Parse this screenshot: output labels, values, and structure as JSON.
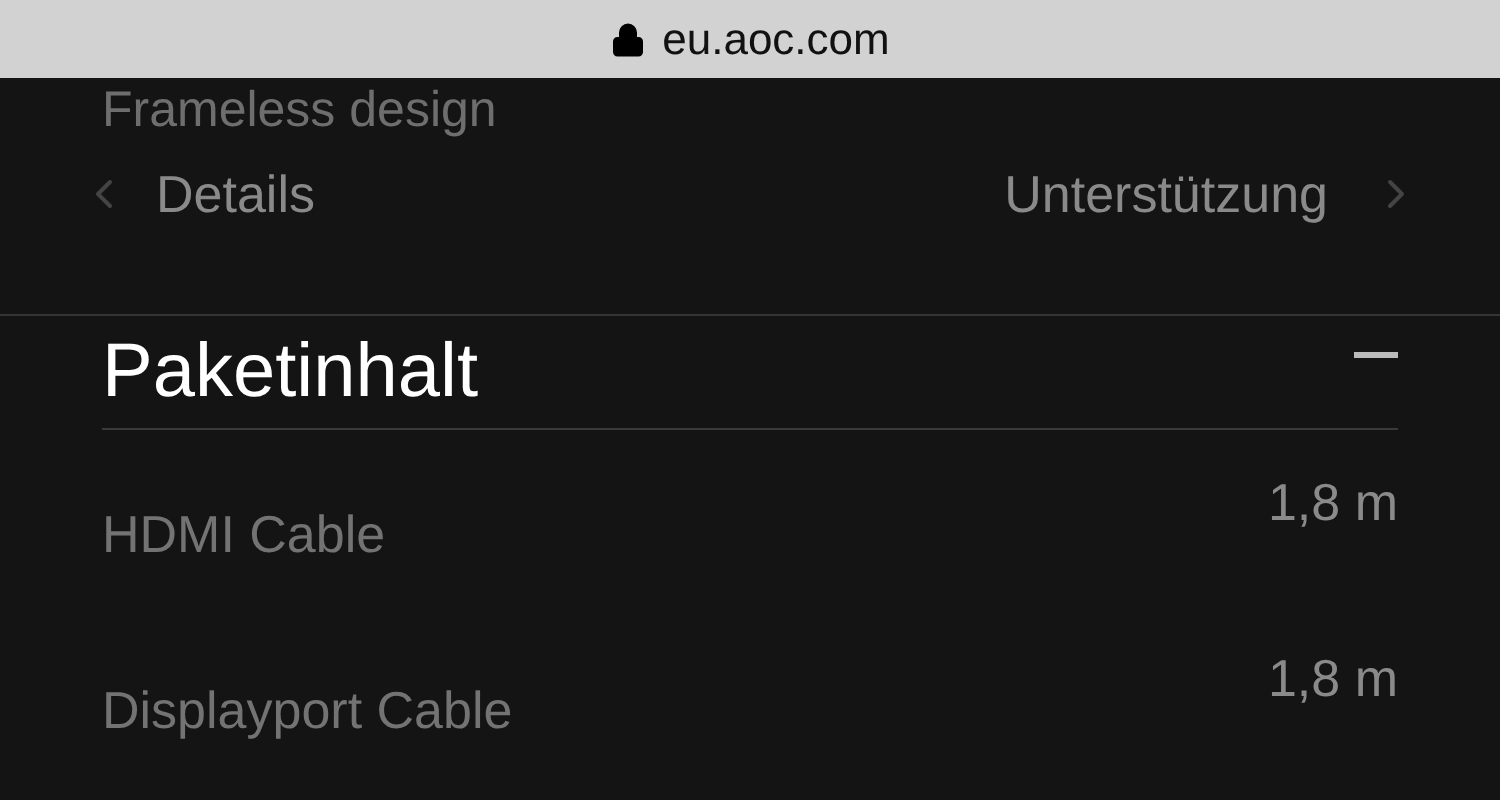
{
  "address_bar": {
    "url": "eu.aoc.com"
  },
  "feature_text": "Frameless design",
  "nav": {
    "previous": "Details",
    "next": "Unterstützung"
  },
  "section": {
    "title": "Paketinhalt",
    "expanded": true,
    "rows": [
      {
        "label": "HDMI Cable",
        "value": "1,8 m"
      },
      {
        "label": "Displayport Cable",
        "value": "1,8 m"
      }
    ]
  }
}
